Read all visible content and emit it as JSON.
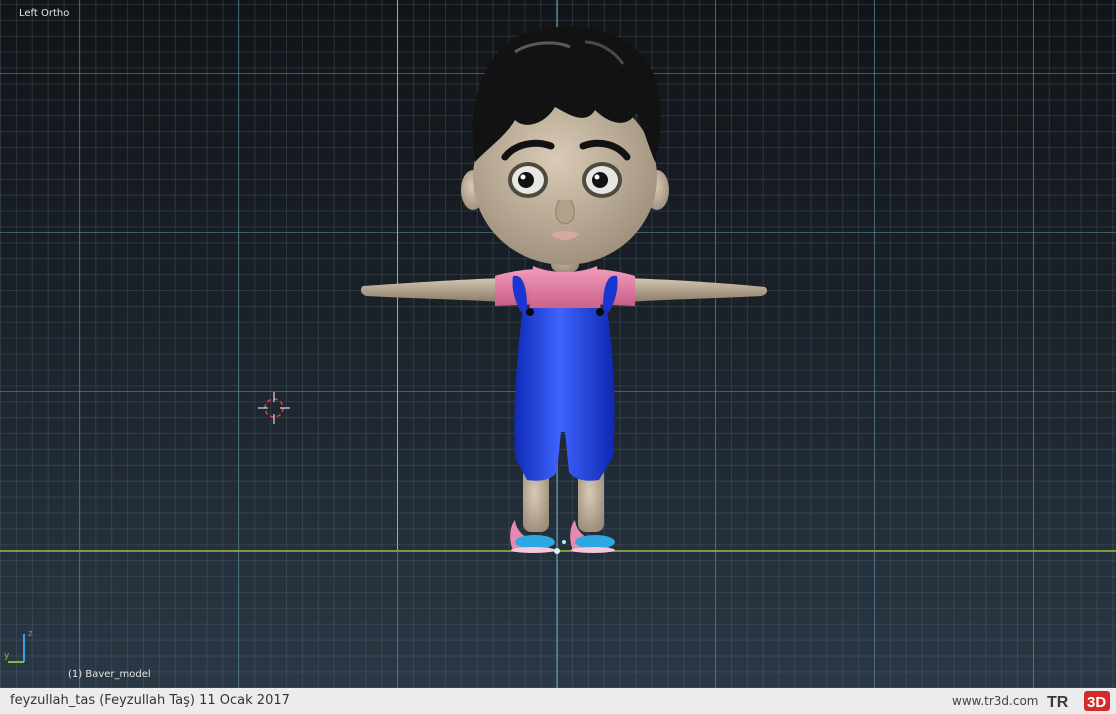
{
  "viewport": {
    "view_label": "Left Ortho",
    "object_label": "(1) Baver_model"
  },
  "axes_widget": {
    "z_label": "z",
    "y_label": "y"
  },
  "footer": {
    "credit": "feyzullah_tas (Feyzullah Taş)  11 Ocak 2017",
    "site": "www.tr3d.com",
    "logo_text": "TR3D"
  },
  "colors": {
    "skin": "#c2b29d",
    "shirt": "#e07ba0",
    "overalls": "#1f3fe0",
    "hair": "#111111",
    "floor_axis": "#7f9a3a",
    "vertical_axis": "#c9a43a"
  }
}
